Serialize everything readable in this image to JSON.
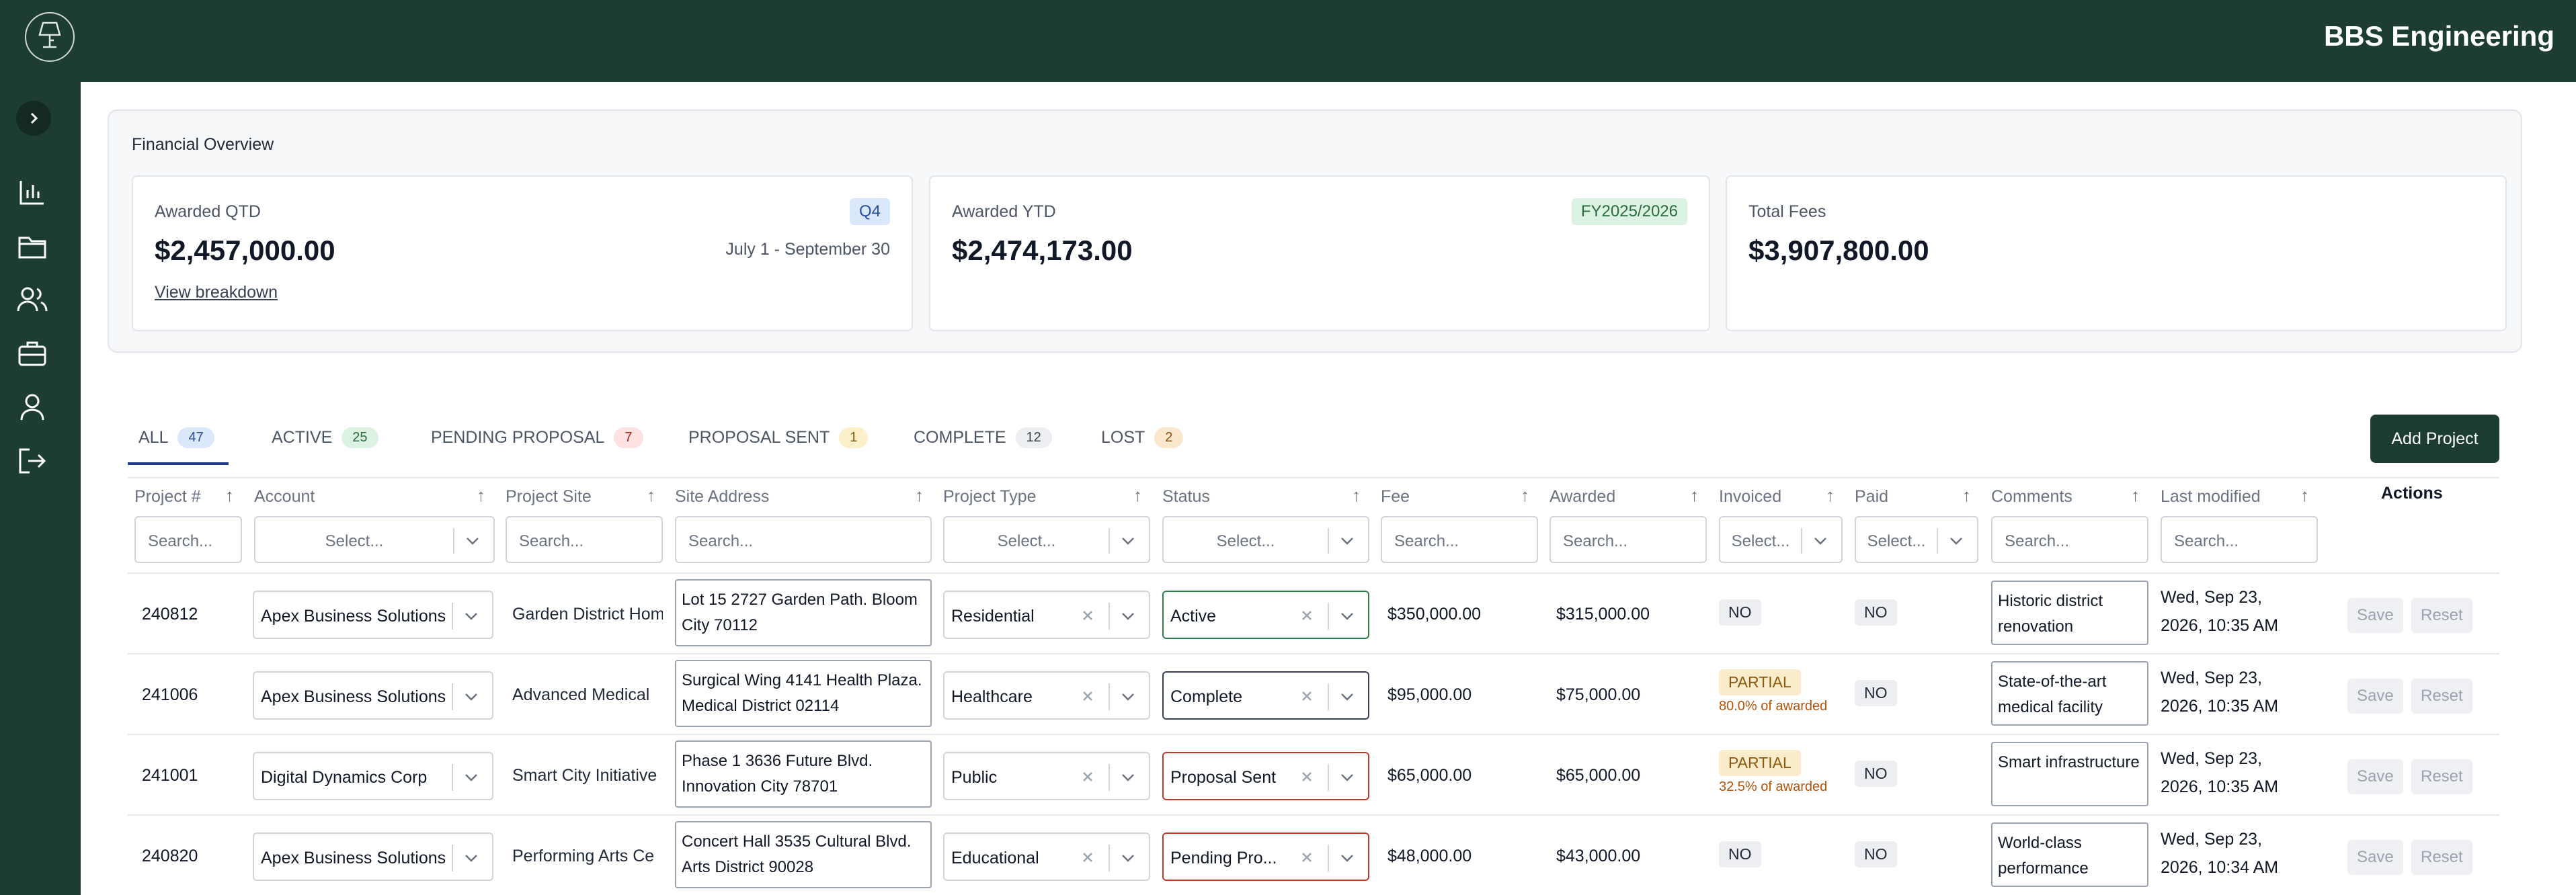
{
  "app": {
    "company": "BBS Engineering"
  },
  "sidebar": {
    "icons": [
      "lamp-logo-icon",
      "chevron-right-icon",
      "bar-chart-icon",
      "folder-icon",
      "users-icon",
      "briefcase-icon",
      "user-icon",
      "logout-icon"
    ]
  },
  "overview": {
    "title": "Financial Overview",
    "cards": [
      {
        "label": "Awarded QTD",
        "value": "$2,457,000.00",
        "badge": "Q4",
        "range": "July 1 - September 30",
        "link": "View breakdown"
      },
      {
        "label": "Awarded YTD",
        "value": "$2,474,173.00",
        "badge": "FY2025/2026"
      },
      {
        "label": "Total Fees",
        "value": "$3,907,800.00"
      }
    ]
  },
  "tabs": [
    {
      "label": "ALL",
      "count": "47",
      "color": "#dbe7fb",
      "text": "#2a4f9b"
    },
    {
      "label": "ACTIVE",
      "count": "25",
      "color": "#dcf3e3",
      "text": "#2b6b3f"
    },
    {
      "label": "PENDING PROPOSAL",
      "count": "7",
      "color": "#fde2e1",
      "text": "#b42318"
    },
    {
      "label": "PROPOSAL SENT",
      "count": "1",
      "color": "#fbf0c9",
      "text": "#7a5b06"
    },
    {
      "label": "COMPLETE",
      "count": "12",
      "color": "#eceef1",
      "text": "#374151"
    },
    {
      "label": "LOST",
      "count": "2",
      "color": "#fbe7cd",
      "text": "#8a4b0b"
    }
  ],
  "toolbar": {
    "add_project": "Add Project"
  },
  "table": {
    "headers": {
      "project": "Project #",
      "account": "Account",
      "site": "Project Site",
      "address": "Site Address",
      "type": "Project Type",
      "status": "Status",
      "fee": "Fee",
      "awarded": "Awarded",
      "invoiced": "Invoiced",
      "paid": "Paid",
      "comments": "Comments",
      "modified": "Last modified",
      "actions": "Actions"
    },
    "filters": {
      "search": "Search...",
      "select": "Select..."
    },
    "rows": [
      {
        "project": "240812",
        "account": "Apex Business Solutions",
        "site": "Garden District Hom",
        "address": "Lot 15 2727 Garden Path. Bloom City 70112",
        "type": "Residential",
        "status": "Active",
        "status_color": "#2e7d4f",
        "fee": "$350,000.00",
        "awarded": "$315,000.00",
        "invoiced": "NO",
        "invoiced_sub": "",
        "paid": "NO",
        "comments": "Historic district renovation",
        "modified": "Wed, Sep 23, 2026, 10:35 AM",
        "save": "Save",
        "reset": "Reset"
      },
      {
        "project": "241006",
        "account": "Apex Business Solutions",
        "site": "Advanced Medical",
        "address": "Surgical Wing 4141 Health Plaza. Medical District 02114",
        "type": "Healthcare",
        "status": "Complete",
        "status_color": "#374151",
        "fee": "$95,000.00",
        "awarded": "$75,000.00",
        "invoiced": "PARTIAL",
        "invoiced_sub": "80.0% of awarded",
        "paid": "NO",
        "comments": "State-of-the-art medical facility",
        "modified": "Wed, Sep 23, 2026, 10:35 AM",
        "save": "Save",
        "reset": "Reset"
      },
      {
        "project": "241001",
        "account": "Digital Dynamics Corp",
        "site": "Smart City Initiative",
        "address": "Phase 1 3636 Future Blvd. Innovation City 78701",
        "type": "Public",
        "status": "Proposal Sent",
        "status_color": "#c0392b",
        "fee": "$65,000.00",
        "awarded": "$65,000.00",
        "invoiced": "PARTIAL",
        "invoiced_sub": "32.5% of awarded",
        "paid": "NO",
        "comments": "Smart infrastructure",
        "modified": "Wed, Sep 23, 2026, 10:35 AM",
        "save": "Save",
        "reset": "Reset"
      },
      {
        "project": "240820",
        "account": "Apex Business Solutions",
        "site": "Performing Arts Ce",
        "address": "Concert Hall 3535 Cultural Blvd. Arts District 90028",
        "type": "Educational",
        "status": "Pending Pro...",
        "status_color": "#c0392b",
        "fee": "$48,000.00",
        "awarded": "$43,000.00",
        "invoiced": "NO",
        "invoiced_sub": "",
        "paid": "NO",
        "comments": "World-class performance",
        "modified": "Wed, Sep 23, 2026, 10:34 AM",
        "save": "Save",
        "reset": "Reset"
      }
    ]
  }
}
